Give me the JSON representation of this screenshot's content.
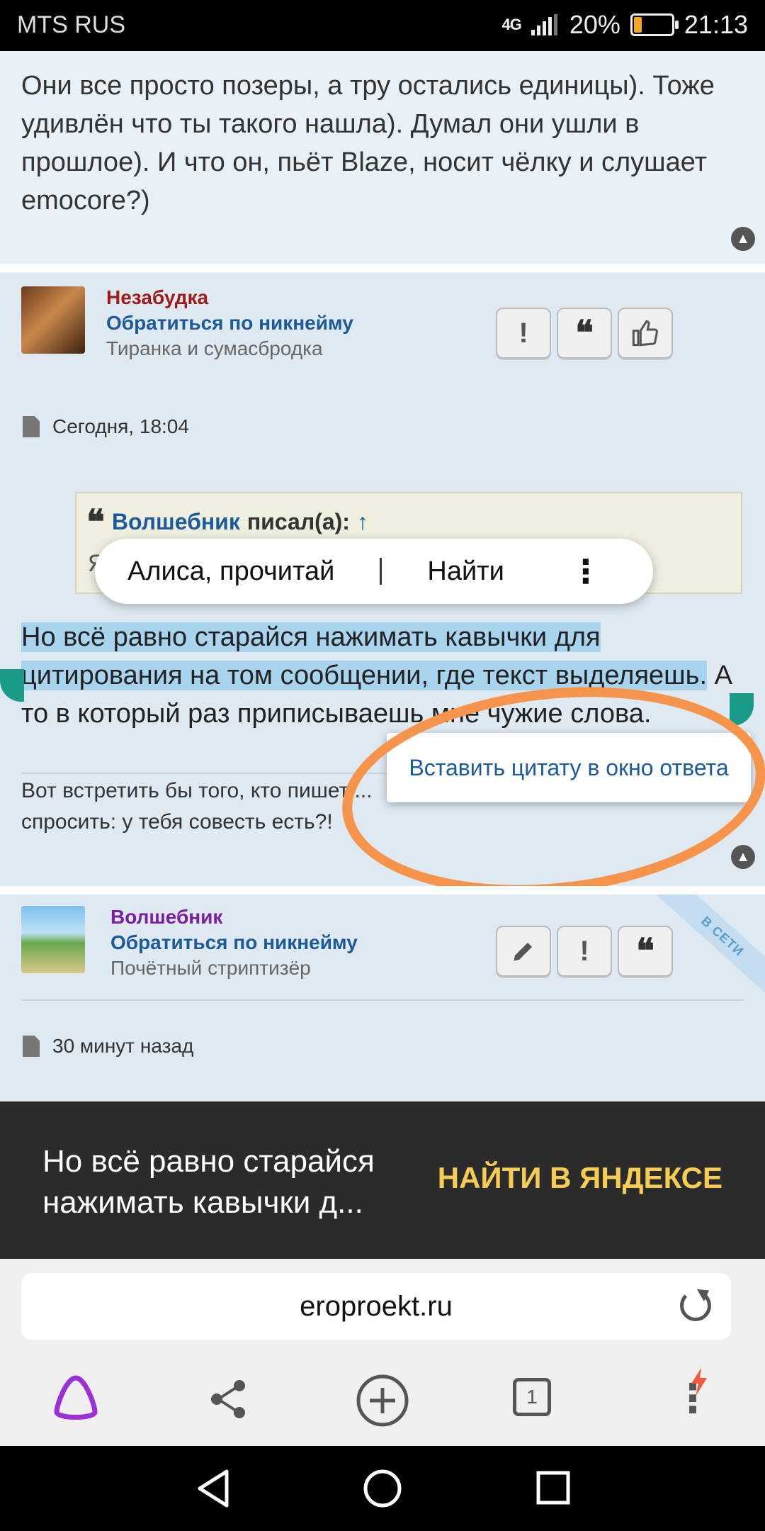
{
  "status_bar": {
    "carrier": "MTS RUS",
    "network": "4G",
    "battery_percent": "20%",
    "battery_level": 0.2,
    "time": "21:13"
  },
  "post_previous": {
    "text": "Они все просто позеры, а тру остались единицы). Тоже удивлён что ты такого нашла). Думал они ушли в прошлое). И что он, пьёт Blaze, носит чёлку и слушает emocore?)"
  },
  "post_main": {
    "author": {
      "name": "Незабудка",
      "name_color": "#a01c1c",
      "address_link": "Обратиться по никнейму",
      "title": "Тиранка и сумасбродка"
    },
    "buttons": [
      "report-button",
      "quote-button",
      "like-button"
    ],
    "date": "Сегодня, 18:04",
    "quote": {
      "author": "Волшебник",
      "wrote": "писал(а):",
      "arrow": "↑",
      "partial_text": "Я"
    },
    "text_selected": "Но всё равно старайся нажимать кавычки для цитирования на том сообщении, где текст выделяешь.",
    "text_rest": "А то в который раз приписываешь мне чужие слова.",
    "signature": "Вот встретить бы того, кто пишет ... спросить: у тебя совесть есть?!"
  },
  "selection_popup": {
    "items": [
      "Алиса, прочитай",
      "Найти"
    ]
  },
  "context_menu": {
    "item": "Вставить цитату в окно ответа"
  },
  "post_next": {
    "author": {
      "name": "Волшебник",
      "name_color": "#7a1fa2",
      "address_link": "Обратиться по никнейму",
      "title": "Почётный стриптизёр"
    },
    "online_badge": "В СЕТИ",
    "date": "30 минут назад"
  },
  "search_banner": {
    "query": "Но всё равно старайся нажимать кавычки д...",
    "action": "НАЙТИ В ЯНДЕКСЕ"
  },
  "url_bar": {
    "domain": "eroproekt.ru"
  },
  "toolbar": {
    "tabs_count": "1"
  },
  "colors": {
    "highlight": "#a8d4ee",
    "link": "#1c5a9a",
    "annotation": "#f5944a",
    "banner_action": "#f6cc52"
  }
}
